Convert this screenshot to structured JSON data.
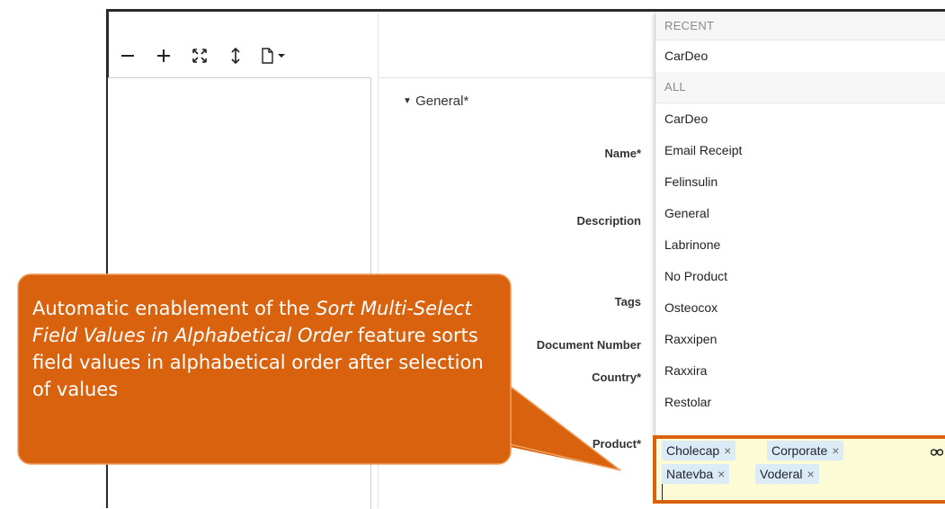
{
  "toolbar": {
    "icons": [
      "minus-icon",
      "plus-icon",
      "fit-screen-icon",
      "expand-vertical-icon",
      "document-menu-icon"
    ]
  },
  "form": {
    "section_title": "General*",
    "labels": {
      "name": "Name*",
      "description": "Description",
      "tags": "Tags",
      "document_number": "Document Number",
      "country": "Country*",
      "product": "Product*"
    }
  },
  "dropdown": {
    "recent_header": "RECENT",
    "recent_items": [
      "CarDeo"
    ],
    "all_header": "ALL",
    "all_items": [
      "CarDeo",
      "Email Receipt",
      "Felinsulin",
      "General",
      "Labrinone",
      "No Product",
      "Osteocox",
      "Raxxipen",
      "Raxxira",
      "Restolar"
    ]
  },
  "product_field": {
    "selected": [
      "Cholecap",
      "Corporate",
      "Natevba",
      "Voderal"
    ],
    "remove_glyph": "×"
  },
  "callout": {
    "text_before": "Automatic enablement of the ",
    "text_italic": "Sort Multi-Select Field Values in Alphabetical Order",
    "text_after": " feature sorts field values in alphabetical order after selection of values",
    "fill_color": "#d9620f",
    "border_color": "#f0a060"
  }
}
